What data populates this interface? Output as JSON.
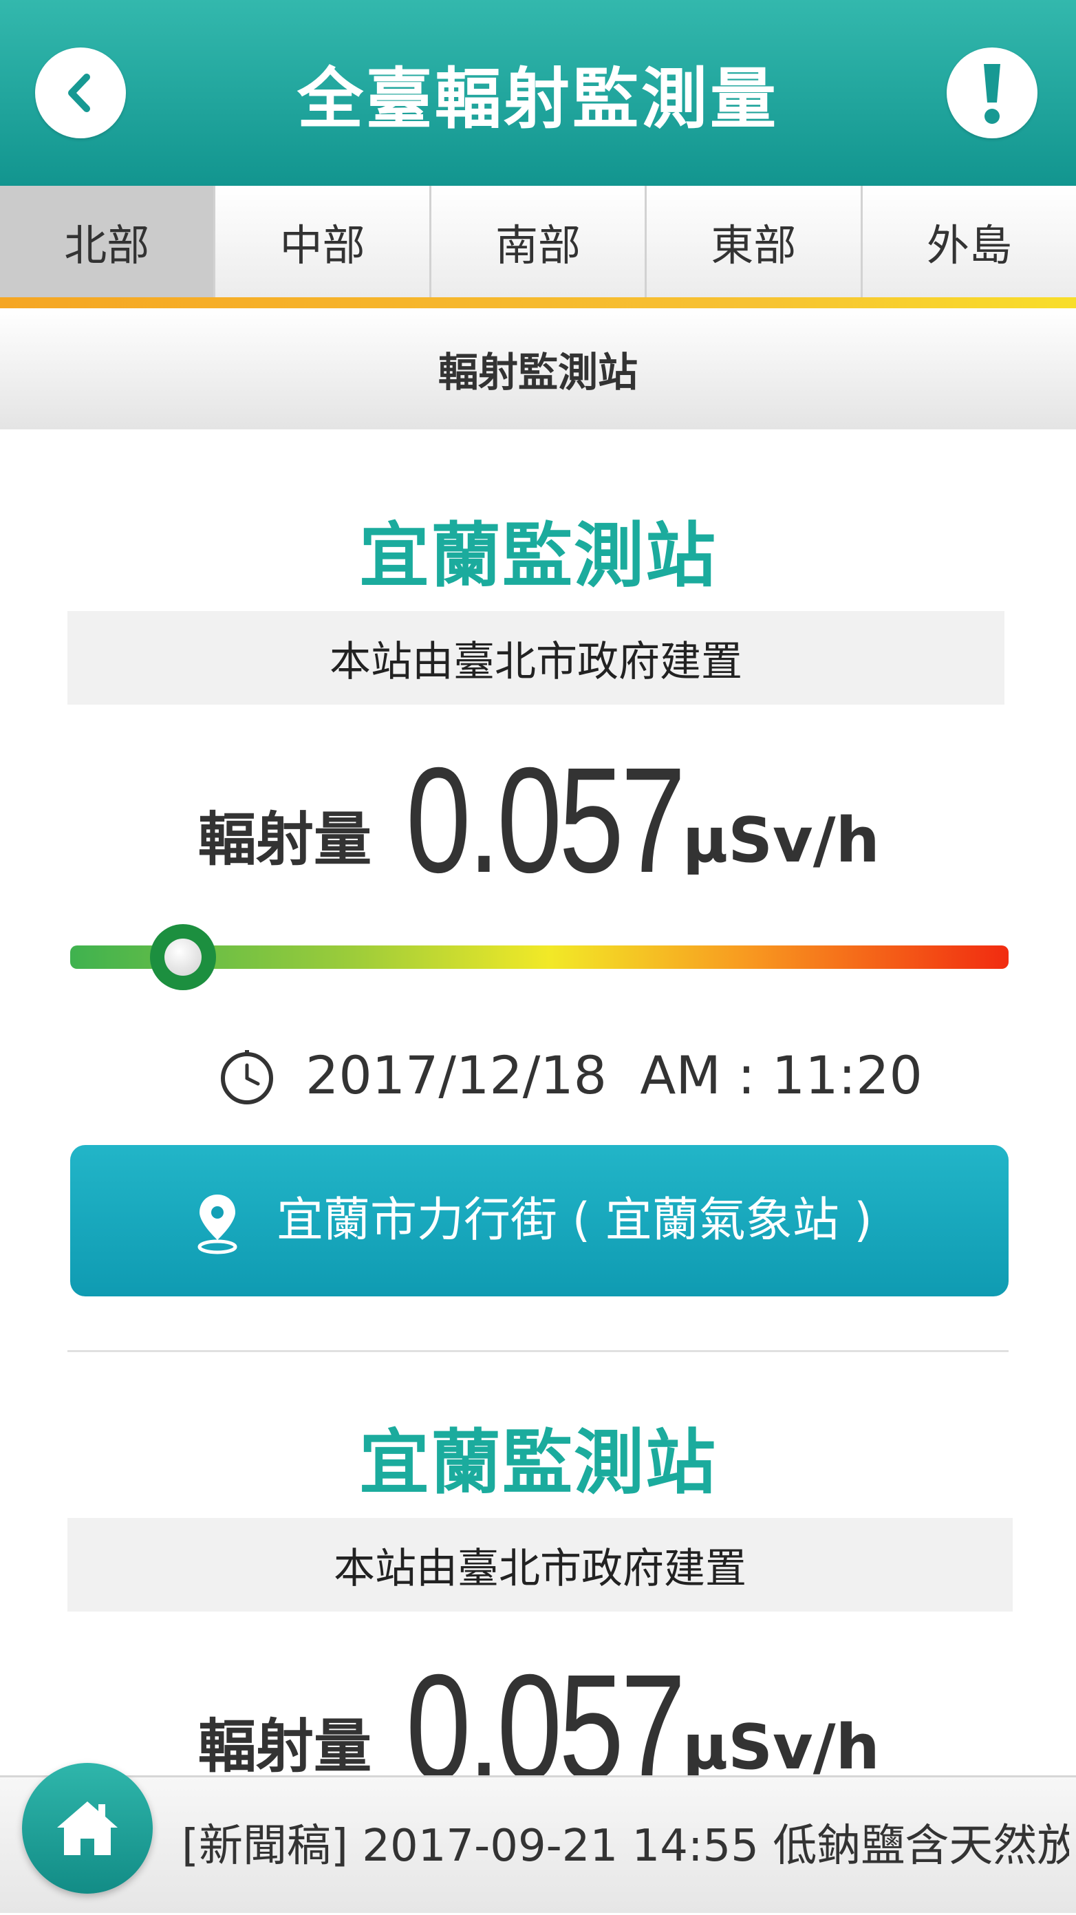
{
  "header": {
    "title": "全臺輻射監測量"
  },
  "tabs": [
    {
      "label": "北部",
      "active": true
    },
    {
      "label": "中部",
      "active": false
    },
    {
      "label": "南部",
      "active": false
    },
    {
      "label": "東部",
      "active": false
    },
    {
      "label": "外島",
      "active": false
    }
  ],
  "section": {
    "title": "輻射監測站"
  },
  "stations": [
    {
      "name": "宜蘭監測站",
      "builder": "本站由臺北市政府建置",
      "reading_label": "輻射量",
      "value": "0.057",
      "unit": "µSv/h",
      "gauge_level": 0.12,
      "timestamp": "2017/12/18  AM : 11:20",
      "location": "宜蘭市力行街 ( 宜蘭氣象站 )"
    },
    {
      "name": "宜蘭監測站",
      "builder": "本站由臺北市政府建置",
      "reading_label": "輻射量",
      "value": "0.057",
      "unit": "µSv/h"
    }
  ],
  "ticker": {
    "text": "[新聞稿] 2017-09-21  14:55  低鈉鹽含天然放"
  },
  "icons": {
    "back": "chevron-left-icon",
    "info": "exclamation-icon",
    "clock": "clock-icon",
    "location": "map-pin-icon",
    "home": "home-icon"
  },
  "colors": {
    "header": "#1fa59c",
    "station_name": "#1bab9d",
    "location_button": "#16a6bb",
    "tab_underline": "#f5b82a"
  }
}
